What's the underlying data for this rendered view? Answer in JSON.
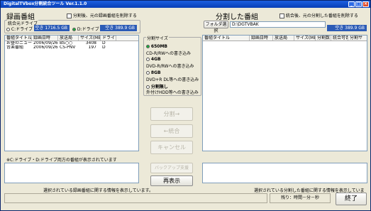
{
  "window": {
    "title": "DigitalTVbox分割統合ツール Ver.1.1.0"
  },
  "left": {
    "title": "録画番組",
    "keep_original": "分割後、元の録画番組を削除する",
    "drive_group": "統合元ドライブ",
    "drive_c": "C:ドライブ",
    "drive_d": "D:ドライブ",
    "free_c": "空き 1716.5 GB",
    "free_d": "空き 389.9 GB",
    "columns": [
      "番組タイトル",
      "録画日時",
      "放送局",
      "サイズ(MB)",
      "ドライブ"
    ],
    "rows": [
      [
        "お昼のニュース",
        "2006/09/26..",
        "BS○○",
        "3408",
        "D"
      ],
      [
        "音楽番組",
        "2006/09/26..",
        "CS-PNV",
        "197",
        "D"
      ]
    ],
    "info_heading": "※C:ドライブ・D:ドライブ両方の番組が表示されています",
    "info_caption": "選択されている録画番組に関する情報を表示しています。"
  },
  "middle": {
    "group": "分割サイズ",
    "options": [
      {
        "label": "650MB",
        "desc": "CD-R/RWへの書き込み"
      },
      {
        "label": "4GB",
        "desc": "DVD-R/RWへの書き込み"
      },
      {
        "label": "8GB",
        "desc": "DVD+R DL等への書き込み"
      },
      {
        "label": "分割無し",
        "desc": "外付けHDD等への書き込み"
      }
    ],
    "btn_split": "分割→",
    "btn_merge": "←統合",
    "btn_cancel": "キャンセル",
    "btn_backup": "バックアップ支援",
    "btn_refresh": "再表示"
  },
  "right": {
    "title": "分割した番組",
    "keep_original": "統合後、元の分割した番組を削除する",
    "folder_button": "フォルダ選択",
    "folder_path": "D:\\DGTVBAK",
    "free": "空き 389.9 GB",
    "columns": [
      "番組タイトル",
      "録画日時",
      "放送局",
      "サイズ(MB)",
      "分割数",
      "統合可否",
      "分割サ"
    ],
    "info_caption": "選択されている分割した番組に関する情報を表示しています。"
  },
  "status": {
    "remaining": "残り：時間－分－秒",
    "exit": "終了"
  }
}
